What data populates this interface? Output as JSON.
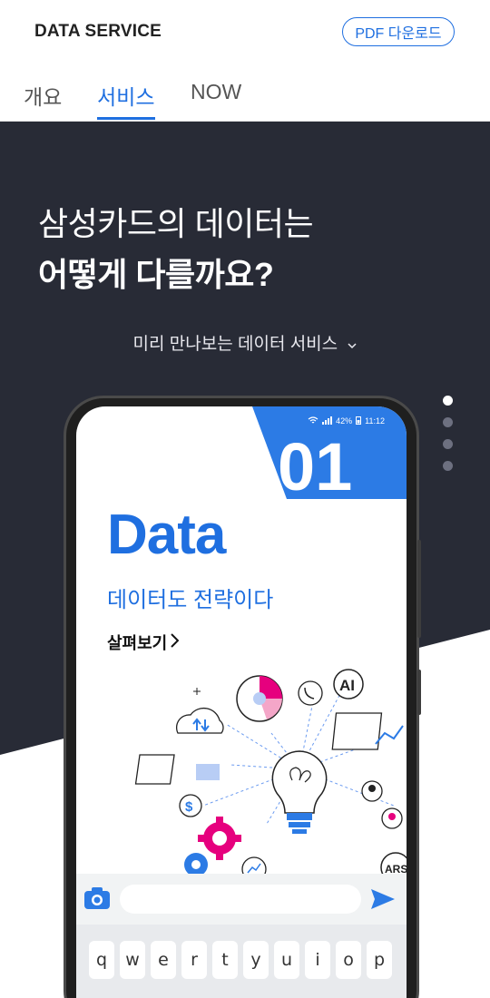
{
  "header": {
    "brand": "DATA SERVICE",
    "pdf_button": "PDF 다운로드"
  },
  "tabs": [
    {
      "label": "개요"
    },
    {
      "label": "서비스",
      "active": true
    },
    {
      "label": "NOW"
    }
  ],
  "hero": {
    "line1": "삼성카드의 데이터는",
    "line2": "어떻게 다를까요?",
    "preview_link": "미리 만나보는 데이터 서비스"
  },
  "carousel": {
    "count": 4,
    "active_index": 0
  },
  "phone": {
    "status": {
      "battery": "42%",
      "time": "11:12"
    },
    "slide_number": "01",
    "title": "Data",
    "subtitle": "데이터도 전략이다",
    "cta": "살펴보기",
    "ai_badge": "AI",
    "ars_badge": "ARS",
    "currency_symbol": "$"
  },
  "keyboard": {
    "row1": [
      "q",
      "w",
      "e",
      "r",
      "t",
      "y",
      "u",
      "i",
      "o",
      "p"
    ]
  },
  "colors": {
    "accent": "#1f6fe0",
    "hero_bg": "#282b36",
    "pink": "#e6007e"
  }
}
